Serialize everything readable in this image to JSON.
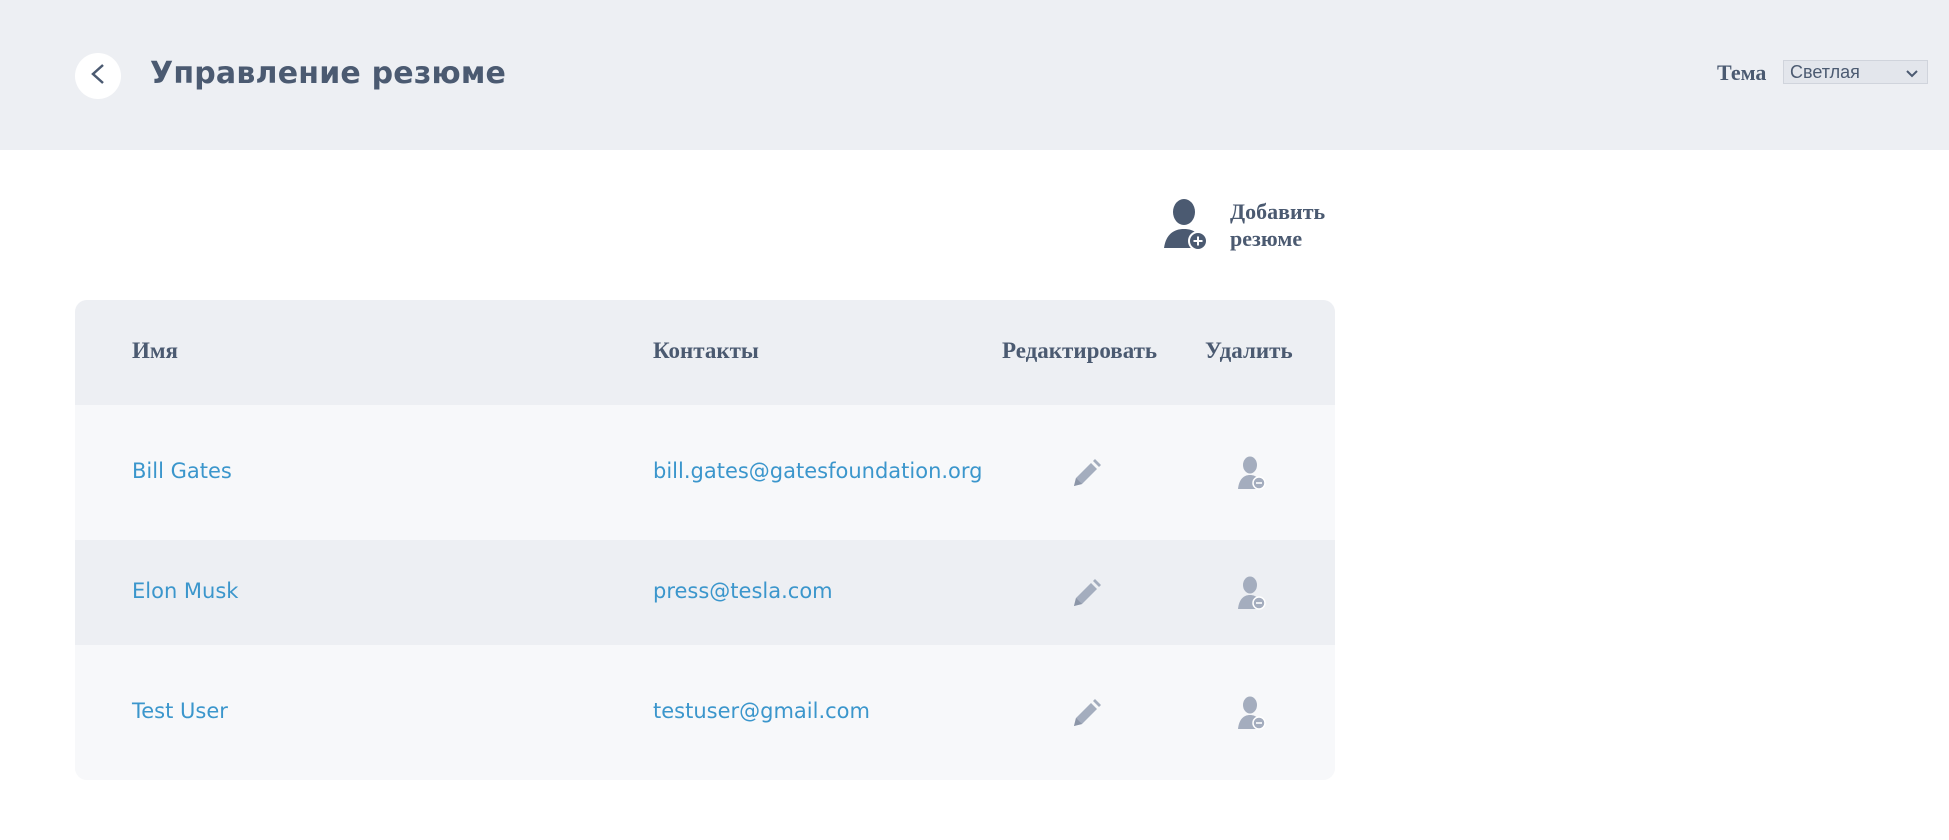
{
  "header": {
    "title": "Управление резюме",
    "back_icon": "chevron-left-icon",
    "theme_label": "Тема",
    "theme_selected": "Светлая"
  },
  "toolbar": {
    "add_resume_label_line1": "Добавить",
    "add_resume_label_line2": "резюме",
    "add_resume_icon": "user-add-icon"
  },
  "table": {
    "columns": [
      "Имя",
      "Контакты",
      "Редактировать",
      "Удалить"
    ],
    "rows": [
      {
        "name": "Bill Gates",
        "contact": "bill.gates@gatesfoundation.org"
      },
      {
        "name": "Elon Musk",
        "contact": "press@tesla.com"
      },
      {
        "name": "Test User",
        "contact": "testuser@gmail.com"
      }
    ],
    "edit_icon": "pencil-icon",
    "delete_icon": "user-remove-icon"
  },
  "colors": {
    "header_bg": "#edeff3",
    "text_dark": "#4b5a71",
    "link": "#3b96cc",
    "icon_muted": "#a4adbe"
  }
}
